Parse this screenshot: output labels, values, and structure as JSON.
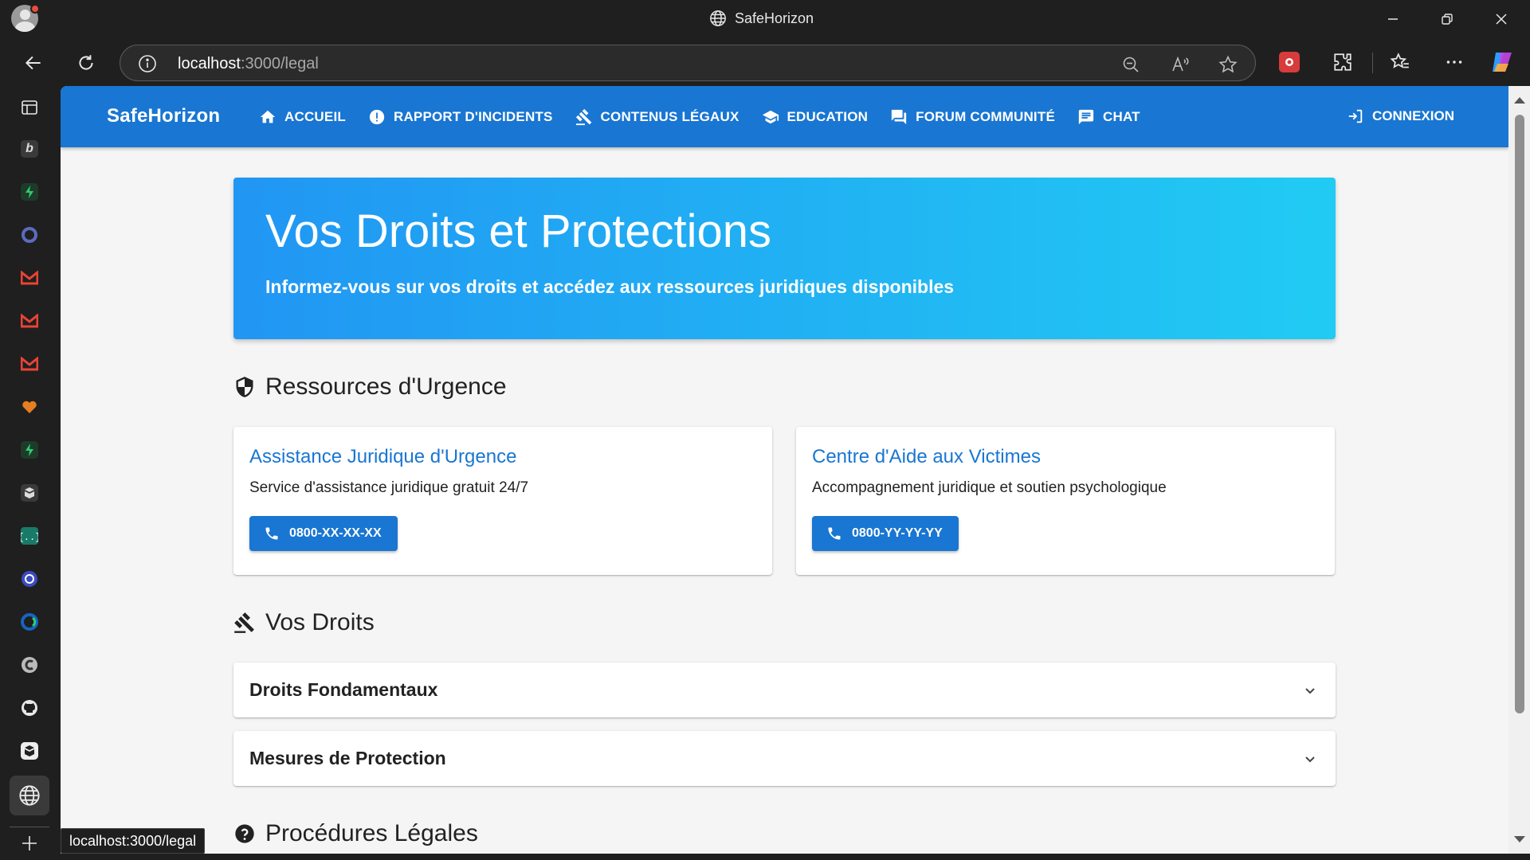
{
  "browser": {
    "window_title": "SafeHorizon",
    "url_host": "localhost",
    "url_path": ":3000/legal",
    "status_tooltip": "localhost:3000/legal"
  },
  "app": {
    "brand": "SafeHorizon",
    "nav": [
      {
        "label": "Accueil",
        "icon": "home-icon"
      },
      {
        "label": "Rapport d'incidents",
        "icon": "alert-icon"
      },
      {
        "label": "Contenus légaux",
        "icon": "gavel-icon"
      },
      {
        "label": "Education",
        "icon": "school-icon"
      },
      {
        "label": "Forum communité",
        "icon": "forum-icon"
      },
      {
        "label": "Chat",
        "icon": "chat-icon"
      }
    ],
    "login": "Connexion"
  },
  "hero": {
    "title": "Vos Droits et Protections",
    "subtitle": "Informez-vous sur vos droits et accédez aux ressources juridiques disponibles"
  },
  "emergency": {
    "title": "Ressources d'Urgence",
    "cards": [
      {
        "title": "Assistance Juridique d'Urgence",
        "description": "Service d'assistance juridique gratuit 24/7",
        "phone": "0800-XX-XX-XX"
      },
      {
        "title": "Centre d'Aide aux Victimes",
        "description": "Accompagnement juridique et soutien psychologique",
        "phone": "0800-YY-YY-YY"
      }
    ]
  },
  "rights": {
    "title": "Vos Droits",
    "items": [
      {
        "label": "Droits Fondamentaux"
      },
      {
        "label": "Mesures de Protection"
      }
    ]
  },
  "procedures": {
    "title": "Procédures Légales"
  },
  "colors": {
    "primary": "#1976d2",
    "hero_gradient_start": "#2196f3",
    "hero_gradient_end": "#21cbf3"
  }
}
